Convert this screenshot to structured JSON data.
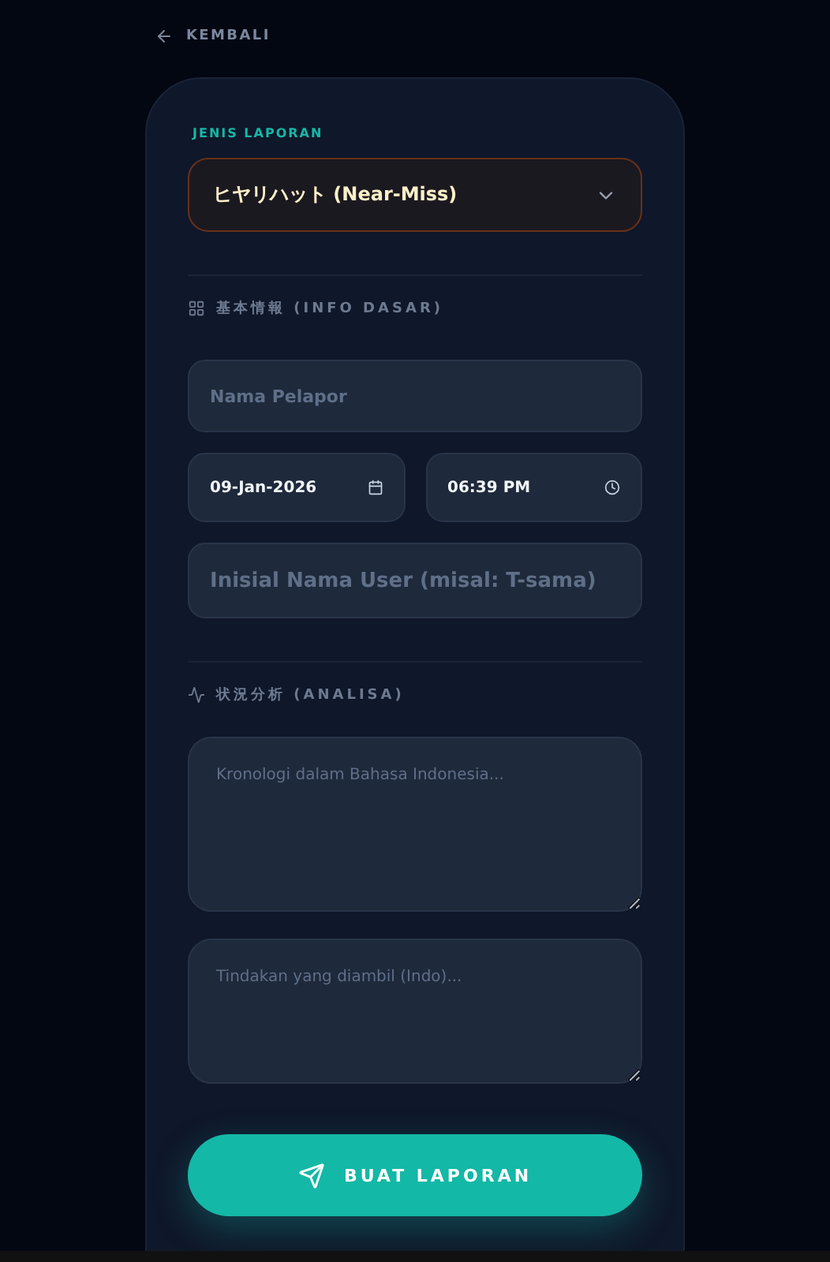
{
  "back_link": {
    "label": "KEMBALI"
  },
  "report_type": {
    "label": "JENIS LAPORAN",
    "value": "ヒヤリハット (Near-Miss)"
  },
  "basic_info": {
    "heading": "基本情報 (INFO DASAR)",
    "reporter": {
      "placeholder": "Nama Pelapor"
    },
    "date": {
      "value": "09-Jan-2026"
    },
    "time": {
      "value": "06:39 PM"
    },
    "user_initials": {
      "placeholder": "Inisial Nama User (misal: T-sama)"
    }
  },
  "analysis": {
    "heading": "状況分析 (ANALISA)",
    "chronology": {
      "placeholder": "Kronologi dalam Bahasa Indonesia..."
    },
    "action_taken": {
      "placeholder": "Tindakan yang diambil (Indo)..."
    }
  },
  "submit_button": {
    "label": "BUAT LAPORAN"
  }
}
